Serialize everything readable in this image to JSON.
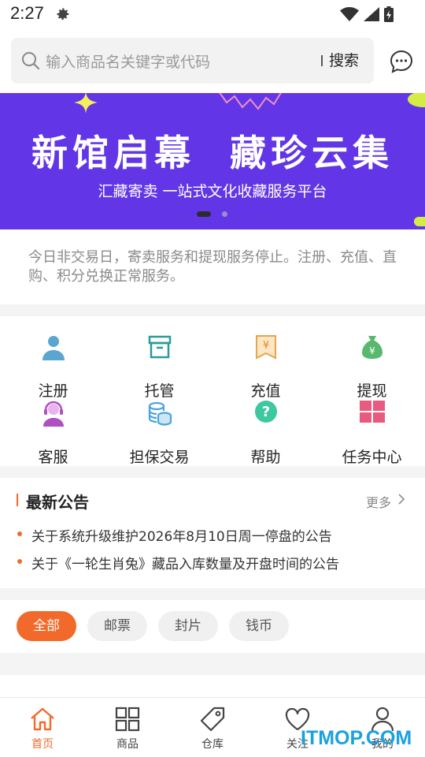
{
  "status_bar": {
    "time": "2:27",
    "icons": [
      "gear-icon",
      "wifi-icon",
      "signal-icon",
      "battery-charging-icon"
    ]
  },
  "search": {
    "placeholder": "输入商品名关键字或代码",
    "button_label": "搜索",
    "message_icon": "chat-bubble-icon"
  },
  "banner": {
    "title": "新馆启幕  藏珍云集",
    "subtitle": "汇藏寄卖 一站式文化收藏服务平台",
    "slide_count": 2,
    "active_slide": 1,
    "background_color": "#6236e6"
  },
  "notice": {
    "text": "今日非交易日，寄卖服务和提现服务停止。注册、充值、直购、积分兑换正常服务。"
  },
  "menu": {
    "items": [
      {
        "label": "注册",
        "icon": "user-icon",
        "color": "#5aa6cf"
      },
      {
        "label": "托管",
        "icon": "archive-box-icon",
        "color": "#2b9a9a"
      },
      {
        "label": "充值",
        "icon": "yen-coupon-icon",
        "color": "#e8a54a"
      },
      {
        "label": "提现",
        "icon": "money-bag-icon",
        "color": "#58b86e"
      },
      {
        "label": "客服",
        "icon": "headset-agent-icon",
        "color": "#b04fc2"
      },
      {
        "label": "担保交易",
        "icon": "coin-stack-icon",
        "color": "#4da3d9"
      },
      {
        "label": "帮助",
        "icon": "help-circle-icon",
        "color": "#3ec8a0"
      },
      {
        "label": "任务中心",
        "icon": "grid-tiles-icon",
        "color": "#e85a7e"
      }
    ]
  },
  "announcements": {
    "title": "最新公告",
    "more_label": "更多",
    "items": [
      "关于系统升级维护2026年8月10日周一停盘的公告",
      "关于《一轮生肖兔》藏品入库数量及开盘时间的公告"
    ]
  },
  "categories": {
    "items": [
      "全部",
      "邮票",
      "封片",
      "钱币"
    ],
    "selected": "全部"
  },
  "tabbar": {
    "items": [
      {
        "label": "首页",
        "icon": "home-icon",
        "active": true
      },
      {
        "label": "商品",
        "icon": "apps-grid-icon",
        "active": false
      },
      {
        "label": "仓库",
        "icon": "tag-icon",
        "active": false
      },
      {
        "label": "关注",
        "icon": "heart-icon",
        "active": false
      },
      {
        "label": "我的",
        "icon": "person-icon",
        "active": false
      }
    ]
  },
  "colors": {
    "accent": "#f26a2b",
    "banner": "#6236e6"
  },
  "watermark": "ITMOP.COM"
}
